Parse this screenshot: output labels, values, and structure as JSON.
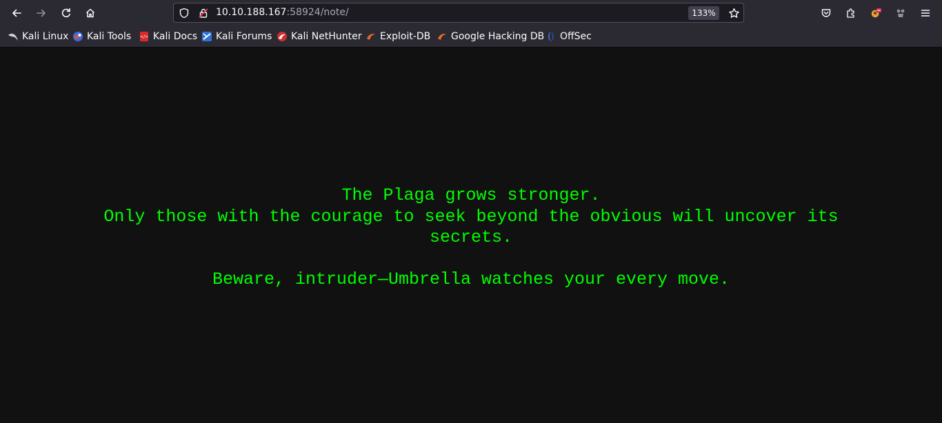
{
  "browser": {
    "url_host": "10.10.188.167",
    "url_path": ":58924/note/",
    "zoom": "133%"
  },
  "icons": {
    "back": "arrow-left-icon",
    "forward": "arrow-right-icon",
    "reload": "reload-icon",
    "home": "home-icon",
    "shield": "shield-icon",
    "lock": "lock-warning-icon",
    "bookmark_star": "star-icon",
    "pocket": "pocket-icon",
    "extensions": "puzzle-icon",
    "profile": "profile-icon",
    "extension2": "extension-icon",
    "menu": "hamburger-menu-icon"
  },
  "bookmarks": [
    {
      "label": "Kali Linux",
      "icon": "kali-dragon-icon"
    },
    {
      "label": "Kali Tools",
      "icon": "kali-tools-icon"
    },
    {
      "label": "Kali Docs",
      "icon": "kali-docs-icon"
    },
    {
      "label": "Kali Forums",
      "icon": "kali-forums-icon"
    },
    {
      "label": "Kali NetHunter",
      "icon": "nethunter-icon"
    },
    {
      "label": "Exploit-DB",
      "icon": "exploit-db-icon"
    },
    {
      "label": "Google Hacking DB",
      "icon": "ghdb-icon"
    },
    {
      "label": "OffSec",
      "icon": "offsec-icon"
    }
  ],
  "note": {
    "line1": "The Plaga grows stronger.",
    "line2": "Only those with the courage to seek beyond the obvious will uncover its secrets.",
    "line3": "Beware, intruder—Umbrella watches your every move."
  },
  "colors": {
    "toolbar_bg": "#2b2a33",
    "page_bg": "#111111",
    "note_text": "#00ff00"
  }
}
